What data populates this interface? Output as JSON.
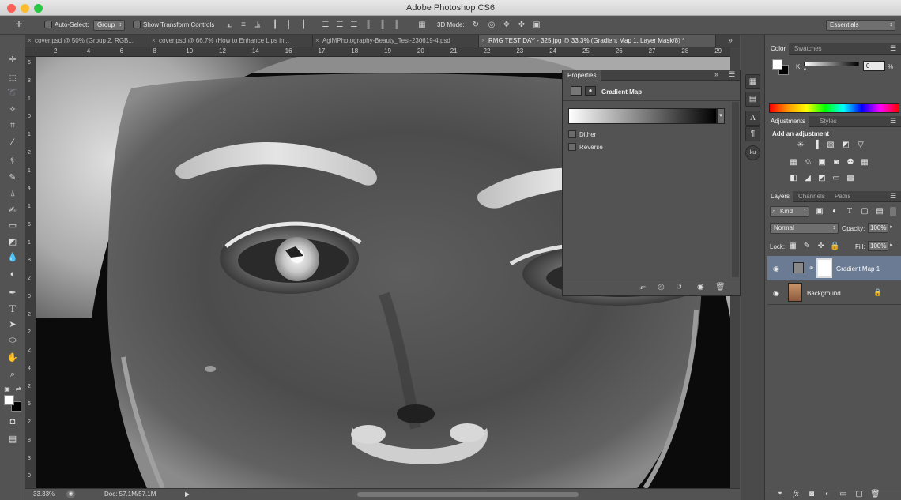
{
  "window": {
    "title": "Adobe Photoshop CS6",
    "colors": {
      "close": "#fc5f57",
      "minimize": "#fdbc2e",
      "zoom": "#28c840"
    }
  },
  "options_bar": {
    "auto_select_label": "Auto-Select:",
    "auto_select_value": "Group",
    "show_transform_label": "Show Transform Controls",
    "mode_3d_label": "3D Mode:",
    "workspace": "Essentials"
  },
  "tabs": [
    {
      "label": "cover.psd @ 50% (Group 2, RGB..."
    },
    {
      "label": "cover.psd @ 66.7% (How to Enhance Lips in..."
    },
    {
      "label": "AgiMPhotography-Beauty_Test-230619-4.psd"
    },
    {
      "label": "RMG TEST DAY - 325.jpg @ 33.3% (Gradient Map 1, Layer Mask/8) *",
      "active": true
    }
  ],
  "ruler_top": [
    "2",
    "4",
    "6",
    "8",
    "10",
    "12",
    "14",
    "16",
    "17",
    "18",
    "19",
    "20",
    "21",
    "22",
    "23",
    "24",
    "25",
    "26",
    "27",
    "28",
    "29"
  ],
  "ruler_left": [
    "6",
    "8",
    "1",
    "0",
    "1",
    "2",
    "1",
    "4",
    "1",
    "6",
    "1",
    "8",
    "2",
    "0",
    "2",
    "2",
    "2",
    "4",
    "2",
    "6",
    "2",
    "8",
    "3",
    "0"
  ],
  "status": {
    "zoom": "33.33%",
    "doc": "Doc: 57.1M/57.1M"
  },
  "properties": {
    "title": "Properties",
    "adjustment_name": "Gradient Map",
    "dither_label": "Dither",
    "reverse_label": "Reverse",
    "gradient": {
      "from": "#ffffff",
      "to": "#000000"
    }
  },
  "color_panel": {
    "tabs": [
      "Color",
      "Swatches"
    ],
    "channel_label": "K",
    "value": "0",
    "unit": "%"
  },
  "adjustments_panel": {
    "tabs": [
      "Adjustments",
      "Styles"
    ],
    "hint": "Add an adjustment"
  },
  "layers_panel": {
    "tabs": [
      "Layers",
      "Channels",
      "Paths"
    ],
    "filter_kind": "Kind",
    "blend_mode": "Normal",
    "opacity_label": "Opacity:",
    "opacity_value": "100%",
    "lock_label": "Lock:",
    "fill_label": "Fill:",
    "fill_value": "100%",
    "layers": [
      {
        "name": "Gradient Map 1",
        "selected": true
      },
      {
        "name": "Background",
        "selected": false
      }
    ]
  }
}
